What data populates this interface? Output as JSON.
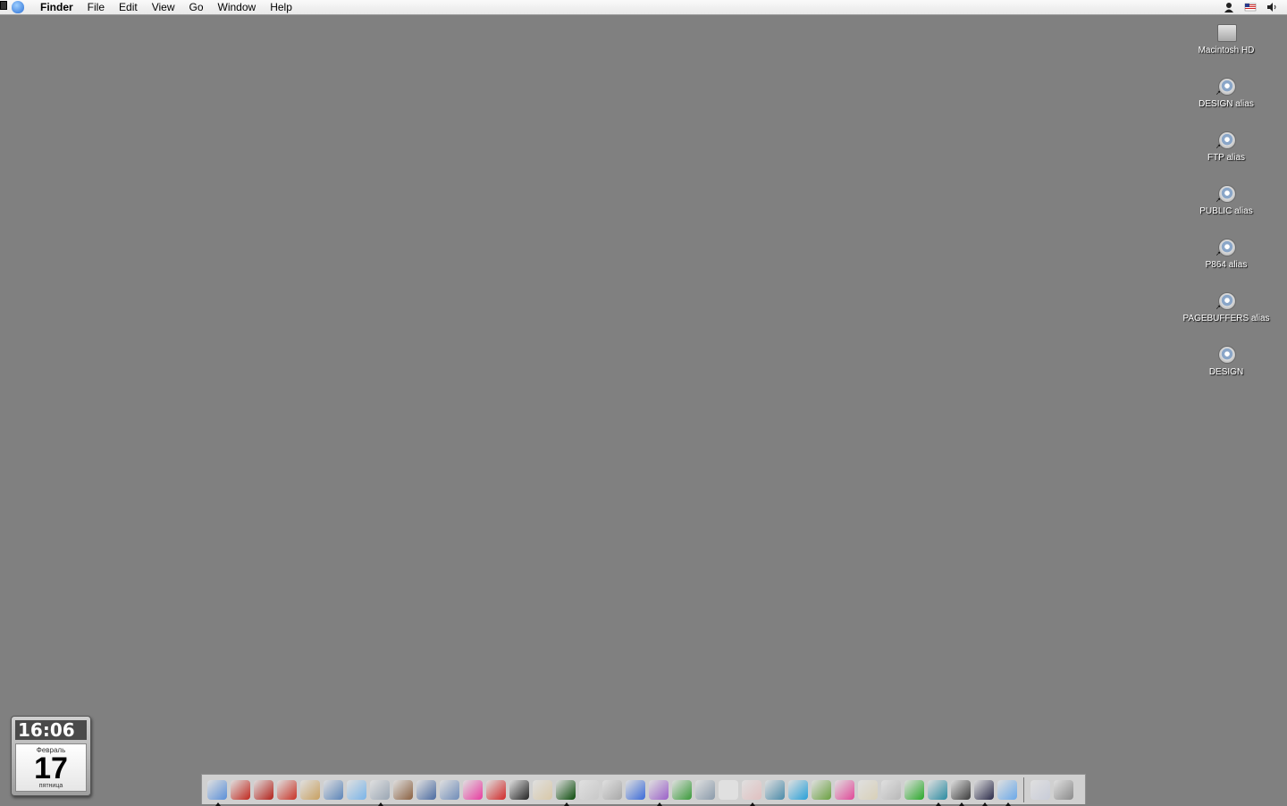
{
  "menubar": {
    "app": "Finder",
    "items": [
      "File",
      "Edit",
      "View",
      "Go",
      "Window",
      "Help"
    ],
    "extras": [
      "user-icon",
      "us-flag-icon",
      "volume-icon"
    ]
  },
  "desktop": {
    "icons": [
      {
        "label": "Macintosh HD",
        "icon": "hard-drive-icon"
      },
      {
        "label": "DESIGN alias",
        "icon": "network-volume-icon"
      },
      {
        "label": "FTP alias",
        "icon": "network-volume-icon"
      },
      {
        "label": "PUBLIC alias",
        "icon": "network-volume-icon"
      },
      {
        "label": "P864 alias",
        "icon": "network-volume-icon"
      },
      {
        "label": "PAGEBUFFERS alias",
        "icon": "network-volume-icon"
      },
      {
        "label": "DESIGN",
        "icon": "network-volume-icon"
      }
    ]
  },
  "widget": {
    "time": "16:06",
    "month": "Февраль",
    "day": "17",
    "weekday": "пятница"
  },
  "dock": {
    "apps": [
      {
        "icon": "finder-icon",
        "color": "#5a8fd8",
        "running": true
      },
      {
        "icon": "acrobat-icon",
        "color": "#c0281e",
        "running": false
      },
      {
        "icon": "acrobat-icon",
        "color": "#b22018",
        "running": false
      },
      {
        "icon": "acrobat-icon",
        "color": "#c83326",
        "running": false
      },
      {
        "icon": "address-book-icon",
        "color": "#c8a060",
        "running": false
      },
      {
        "icon": "app-icon",
        "color": "#5b84b8",
        "running": false
      },
      {
        "icon": "itunes-icon",
        "color": "#7ab4e8",
        "running": false
      },
      {
        "icon": "mail-icon",
        "color": "#9aa6b4",
        "running": true
      },
      {
        "icon": "iphoto-icon",
        "color": "#8a6040",
        "running": false
      },
      {
        "icon": "app-icon",
        "color": "#4a6aa0",
        "running": false
      },
      {
        "icon": "imovie-icon",
        "color": "#6f8cb8",
        "running": false
      },
      {
        "icon": "color-icon",
        "color": "#e83ca0",
        "running": false
      },
      {
        "icon": "app-icon",
        "color": "#d02828",
        "running": false
      },
      {
        "icon": "terminal-icon",
        "color": "#222222",
        "running": false
      },
      {
        "icon": "textedit-icon",
        "color": "#d8c8a8",
        "running": false
      },
      {
        "icon": "activity-monitor-icon",
        "color": "#0a4a0a",
        "running": true
      },
      {
        "icon": "app-icon",
        "color": "#c8c8c8",
        "running": false
      },
      {
        "icon": "calculator-icon",
        "color": "#a8a8a8",
        "running": false
      },
      {
        "icon": "word-icon",
        "color": "#3a6ad8",
        "running": false
      },
      {
        "icon": "app-icon",
        "color": "#9a60c8",
        "running": true
      },
      {
        "icon": "app-icon",
        "color": "#3a9a3a",
        "running": false
      },
      {
        "icon": "app-icon",
        "color": "#8a9aaa",
        "running": false
      },
      {
        "icon": "acrobat-reader-icon",
        "color": "#e0e0e0",
        "running": false
      },
      {
        "icon": "acrobat-reader-icon",
        "color": "#e0c0c0",
        "running": true
      },
      {
        "icon": "app-icon",
        "color": "#4a8aa8",
        "running": false
      },
      {
        "icon": "app-icon",
        "color": "#28a0d8",
        "running": false
      },
      {
        "icon": "app-icon",
        "color": "#6aa040",
        "running": false
      },
      {
        "icon": "app-icon",
        "color": "#e04898",
        "running": false
      },
      {
        "icon": "app-icon",
        "color": "#d8d0b8",
        "running": false
      },
      {
        "icon": "app-icon",
        "color": "#b8b8b8",
        "running": false
      },
      {
        "icon": "icq-icon",
        "color": "#2aa82a",
        "running": false
      },
      {
        "icon": "app-icon",
        "color": "#2a8aa0",
        "running": true
      },
      {
        "icon": "app-icon",
        "color": "#3a3a3a",
        "running": true
      },
      {
        "icon": "app-icon",
        "color": "#2a2a48",
        "running": true
      },
      {
        "icon": "safari-icon",
        "color": "#6aa8e8",
        "running": true
      }
    ],
    "extras": [
      {
        "icon": "document-stack-icon",
        "color": "#c8ccd8"
      },
      {
        "icon": "trash-icon",
        "color": "#8a8a8a"
      }
    ]
  }
}
